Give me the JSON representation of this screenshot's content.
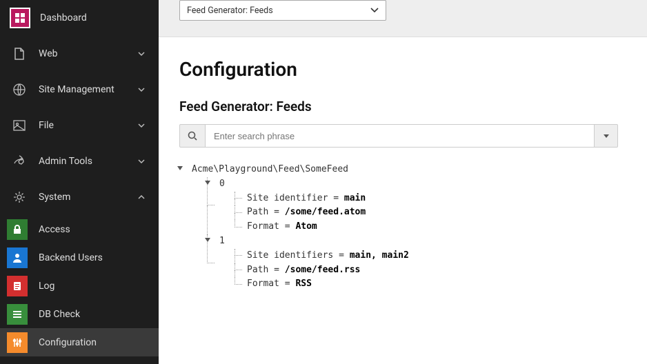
{
  "sidebar": {
    "dashboard": "Dashboard",
    "groups": [
      {
        "label": "Web",
        "expanded": false
      },
      {
        "label": "Site Management",
        "expanded": false
      },
      {
        "label": "File",
        "expanded": false
      },
      {
        "label": "Admin Tools",
        "expanded": false
      },
      {
        "label": "System",
        "expanded": true
      }
    ],
    "system_items": [
      {
        "label": "Access"
      },
      {
        "label": "Backend Users"
      },
      {
        "label": "Log"
      },
      {
        "label": "DB Check"
      },
      {
        "label": "Configuration"
      }
    ]
  },
  "topbar": {
    "selector_label": "Feed Generator: Feeds"
  },
  "page": {
    "title": "Configuration",
    "subtitle": "Feed Generator: Feeds"
  },
  "search": {
    "placeholder": "Enter search phrase",
    "value": ""
  },
  "tree": {
    "root": "Acme\\Playground\\Feed\\SomeFeed",
    "items": [
      {
        "index": "0",
        "rows": [
          {
            "key": "Site identifier",
            "value": "main"
          },
          {
            "key": "Path",
            "value": "/some/feed.atom"
          },
          {
            "key": "Format",
            "value": "Atom"
          }
        ]
      },
      {
        "index": "1",
        "rows": [
          {
            "key": "Site identifiers",
            "value": "main, main2"
          },
          {
            "key": "Path",
            "value": "/some/feed.rss"
          },
          {
            "key": "Format",
            "value": "RSS"
          }
        ]
      }
    ]
  }
}
